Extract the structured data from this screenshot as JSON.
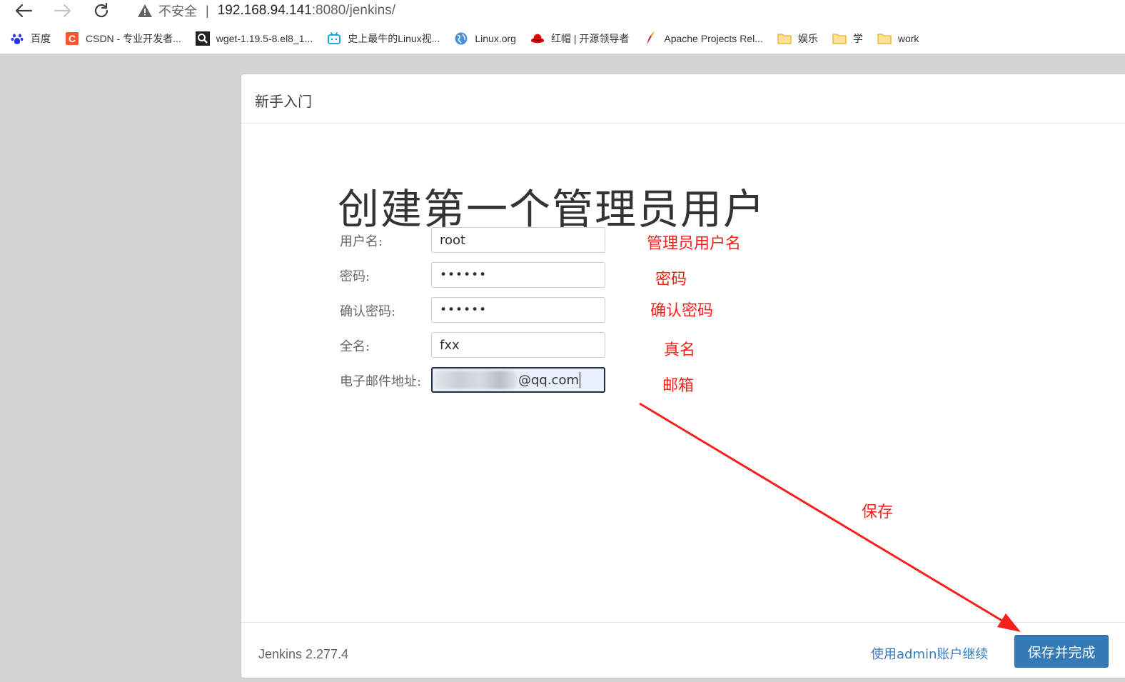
{
  "browser": {
    "insecure_label": "不安全",
    "separator": "|",
    "url_host": "192.168.94.141",
    "url_path": ":8080/jenkins/"
  },
  "bookmarks": [
    {
      "label": "百度",
      "icon": "baidu-paw-icon"
    },
    {
      "label": "CSDN - 专业开发者...",
      "icon": "csdn-icon"
    },
    {
      "label": "wget-1.19.5-8.el8_1...",
      "icon": "search-icon"
    },
    {
      "label": "史上最牛的Linux视...",
      "icon": "bilibili-tv-icon"
    },
    {
      "label": "Linux.org",
      "icon": "globe-icon"
    },
    {
      "label": "红帽 | 开源领导者",
      "icon": "redhat-icon"
    },
    {
      "label": "Apache Projects Rel...",
      "icon": "apache-feather-icon"
    },
    {
      "label": "娱乐",
      "icon": "folder-icon"
    },
    {
      "label": "学",
      "icon": "folder-icon"
    },
    {
      "label": "work",
      "icon": "folder-icon"
    }
  ],
  "dialog": {
    "header_title": "新手入门",
    "heading": "创建第一个管理员用户",
    "fields": {
      "username": {
        "label": "用户名:",
        "value": "root"
      },
      "password": {
        "label": "密码:",
        "value": "••••••"
      },
      "confirm_password": {
        "label": "确认密码:",
        "value": "••••••"
      },
      "fullname": {
        "label": "全名:",
        "value": "fxx"
      },
      "email": {
        "label": "电子邮件地址:",
        "value": "@qq.com"
      }
    },
    "footer": {
      "version": "Jenkins 2.277.4",
      "continue_link": "使用admin账户继续",
      "save_button": "保存并完成"
    }
  },
  "annotations": {
    "username": "管理员用户名",
    "password": "密码",
    "confirm_password": "确认密码",
    "fullname": "真名",
    "email": "邮箱",
    "save": "保存",
    "color": "#f5221b"
  }
}
